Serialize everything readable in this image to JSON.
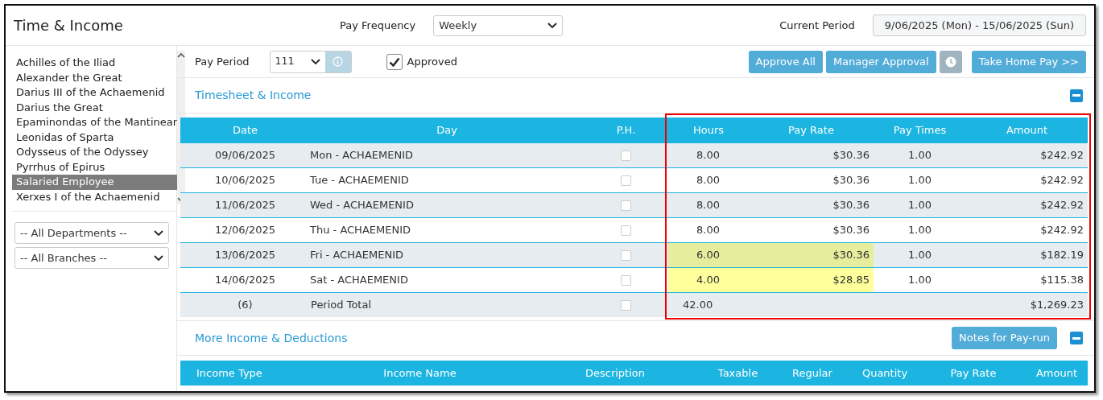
{
  "header": {
    "title": "Time & Income",
    "pay_frequency_label": "Pay Frequency",
    "pay_frequency": "Weekly",
    "current_period_label": "Current Period",
    "current_period": "9/06/2025 (Mon) - 15/06/2025 (Sun)"
  },
  "employees": [
    {
      "name": "Achilles of the Iliad",
      "selected": false
    },
    {
      "name": "Alexander the Great",
      "selected": false
    },
    {
      "name": "Darius III of the Achaemenid",
      "selected": false
    },
    {
      "name": "Darius the Great",
      "selected": false
    },
    {
      "name": "Epaminondas of the Mantinear",
      "selected": false
    },
    {
      "name": "Leonidas of Sparta",
      "selected": false
    },
    {
      "name": "Odysseus of the Odyssey",
      "selected": false
    },
    {
      "name": "Pyrrhus of Epirus",
      "selected": false
    },
    {
      "name": "Salaried Employee",
      "selected": true
    },
    {
      "name": "Xerxes I of the Achaemenid",
      "selected": false
    }
  ],
  "filters": [
    {
      "value": "-- All Departments --"
    },
    {
      "value": "-- All Branches --"
    }
  ],
  "toolbar": {
    "pay_period_label": "Pay Period",
    "pay_period": "111",
    "approved_label": "Approved",
    "approved": true,
    "buttons": [
      {
        "kind": "text",
        "label": "Approve All"
      },
      {
        "kind": "text",
        "label": "Manager Approval"
      },
      {
        "kind": "clock"
      },
      {
        "kind": "text",
        "label": "Take Home Pay >>"
      }
    ]
  },
  "timesheet": {
    "title": "Timesheet & Income",
    "columns": [
      "Date",
      "Day",
      "P.H.",
      "Hours",
      "Pay Rate",
      "Pay Times",
      "Amount"
    ],
    "rows": [
      {
        "date": "09/06/2025",
        "day": "Mon - ACHAEMENID",
        "ph": false,
        "hours": "8.00",
        "pay_rate": "$30.36",
        "pay_times": "1.00",
        "amount": "$242.92",
        "highlighted": false
      },
      {
        "date": "10/06/2025",
        "day": "Tue - ACHAEMENID",
        "ph": false,
        "hours": "8.00",
        "pay_rate": "$30.36",
        "pay_times": "1.00",
        "amount": "$242.92",
        "highlighted": false
      },
      {
        "date": "11/06/2025",
        "day": "Wed - ACHAEMENID",
        "ph": false,
        "hours": "8.00",
        "pay_rate": "$30.36",
        "pay_times": "1.00",
        "amount": "$242.92",
        "highlighted": false
      },
      {
        "date": "12/06/2025",
        "day": "Thu - ACHAEMENID",
        "ph": false,
        "hours": "8.00",
        "pay_rate": "$30.36",
        "pay_times": "1.00",
        "amount": "$242.92",
        "highlighted": false
      },
      {
        "date": "13/06/2025",
        "day": "Fri - ACHAEMENID",
        "ph": false,
        "hours": "6.00",
        "pay_rate": "$30.36",
        "pay_times": "1.00",
        "amount": "$182.19",
        "highlighted": true
      },
      {
        "date": "14/06/2025",
        "day": "Sat - ACHAEMENID",
        "ph": false,
        "hours": "4.00",
        "pay_rate": "$28.85",
        "pay_times": "1.00",
        "amount": "$115.38",
        "highlighted": true
      }
    ],
    "total": {
      "count": "(6)",
      "label": "Period Total",
      "ph": false,
      "hours": "42.00",
      "amount": "$1,269.23"
    }
  },
  "more_income": {
    "title": "More Income & Deductions",
    "notes_button": "Notes for Pay-run",
    "columns": [
      "Income Type",
      "Income Name",
      "Description",
      "Taxable",
      "Regular",
      "Quantity",
      "Pay Rate",
      "Amount"
    ]
  }
}
